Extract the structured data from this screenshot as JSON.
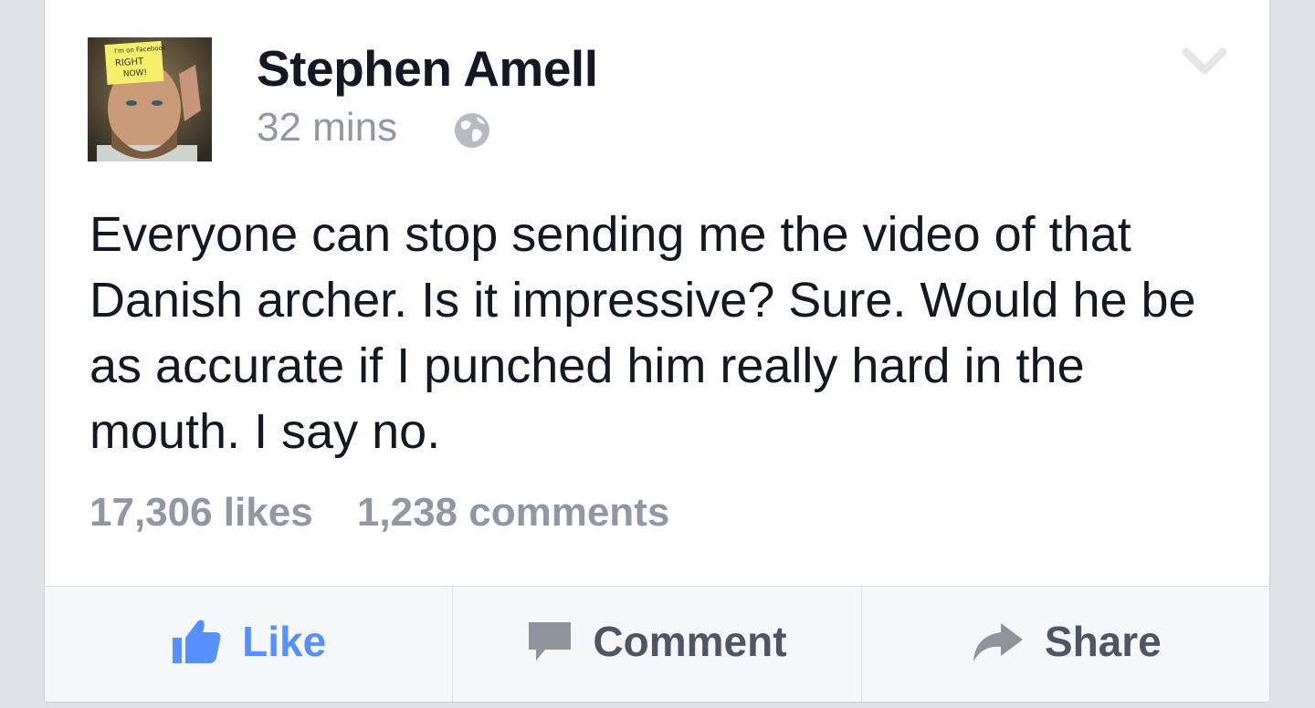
{
  "post": {
    "author": "Stephen Amell",
    "time": "32 mins",
    "privacy_icon": "globe-icon",
    "menu_icon": "chevron-down-icon",
    "avatar_note": [
      "I'm on Facebook",
      "RIGHT",
      "NOW!"
    ],
    "text": "Everyone can stop sending me the video of that Danish archer. Is it impressive? Sure. Would he be as accurate if I punched him really hard in the mouth. I say no.",
    "likes": "17,306 likes",
    "comments": "1,238 comments"
  },
  "actions": {
    "like": {
      "label": "Like",
      "icon": "thumbs-up-icon"
    },
    "comment": {
      "label": "Comment",
      "icon": "speech-bubble-icon"
    },
    "share": {
      "label": "Share",
      "icon": "share-arrow-icon"
    }
  },
  "colors": {
    "like_blue": "#5890ff",
    "meta_gray": "#9197a3",
    "text_dark": "#141823",
    "action_gray": "#4e5665"
  }
}
